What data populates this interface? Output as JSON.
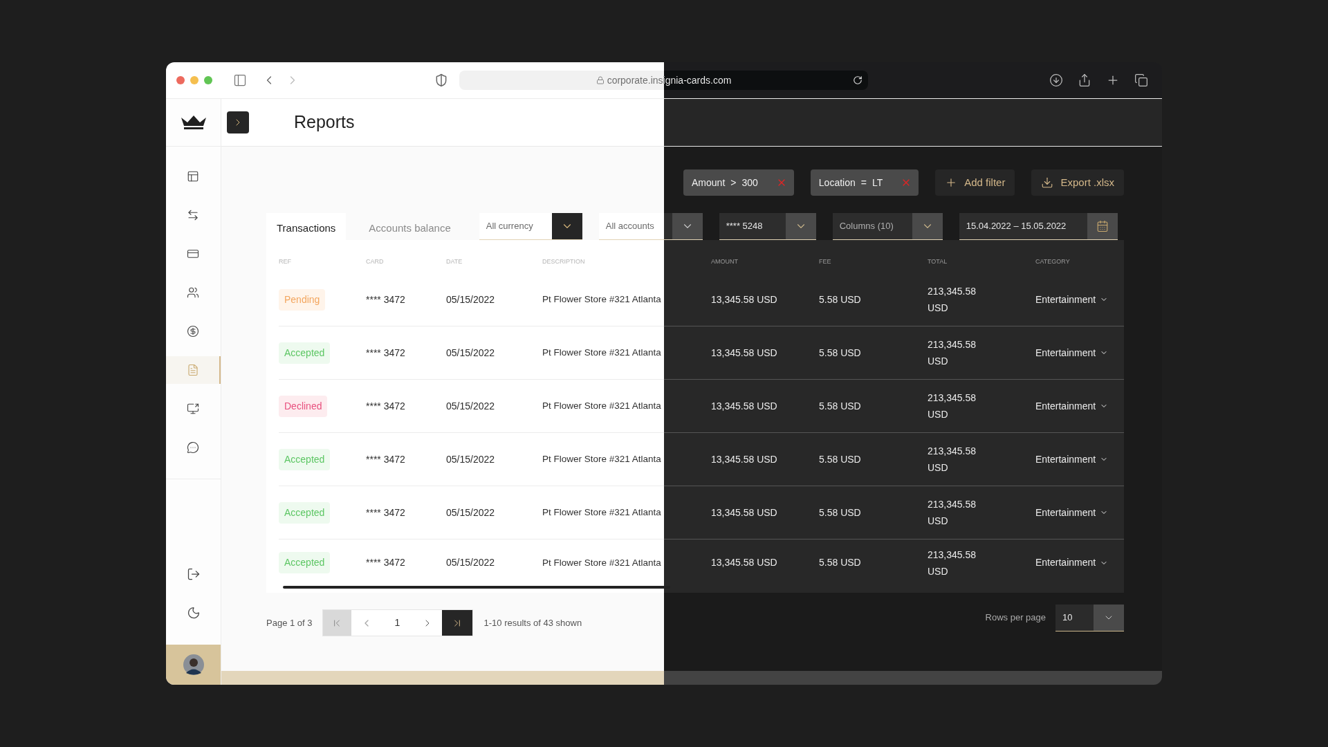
{
  "browser": {
    "url": "corporate.insignia-cards.com"
  },
  "sidebar": {
    "items": [
      {
        "selected": false
      },
      {
        "selected": false
      },
      {
        "selected": false
      },
      {
        "selected": false
      },
      {
        "selected": false
      },
      {
        "selected": true
      },
      {
        "selected": false
      },
      {
        "selected": false
      }
    ]
  },
  "header": {
    "title": "Reports"
  },
  "filters": [
    {
      "field": "Amount",
      "operator": ">",
      "value": "300"
    },
    {
      "field": "Location",
      "operator": "=",
      "value": "LT"
    }
  ],
  "actions": [
    {
      "label": "Add filter",
      "kind": "add"
    },
    {
      "label": "Export .xlsx",
      "kind": "export"
    }
  ],
  "tabs": [
    {
      "label": "Transactions",
      "selected": true
    },
    {
      "label": "Accounts balance",
      "selected": false
    }
  ],
  "dropdowns": [
    {
      "value": "All currency",
      "kind": "select"
    },
    {
      "value": "All accounts",
      "kind": "select"
    },
    {
      "value": "**** 5248",
      "kind": "select"
    },
    {
      "value": "Columns (10)",
      "kind": "select"
    },
    {
      "value": "15.04.2022 – 15.05.2022",
      "kind": "date"
    }
  ],
  "table": {
    "columns": [
      "REF",
      "CARD",
      "DATE",
      "DESCRIPTION",
      "AMOUNT",
      "FEE",
      "TOTAL",
      "CATEGORY"
    ],
    "rows": [
      {
        "status": "Pending",
        "kind": "pending",
        "card": "**** 3472",
        "date": "05/15/2022",
        "description": "Pt Flower Store #321 Atlanta",
        "amount": "13,345.58 USD",
        "fee": "5.58 USD",
        "total": "213,345.58 USD",
        "category": "Entertainment"
      },
      {
        "status": "Accepted",
        "kind": "accepted",
        "card": "**** 3472",
        "date": "05/15/2022",
        "description": "Pt Flower Store #321 Atlanta",
        "amount": "13,345.58 USD",
        "fee": "5.58 USD",
        "total": "213,345.58 USD",
        "category": "Entertainment"
      },
      {
        "status": "Declined",
        "kind": "declined",
        "card": "**** 3472",
        "date": "05/15/2022",
        "description": "Pt Flower Store #321 Atlanta",
        "amount": "13,345.58 USD",
        "fee": "5.58 USD",
        "total": "213,345.58 USD",
        "category": "Entertainment"
      },
      {
        "status": "Accepted",
        "kind": "accepted",
        "card": "**** 3472",
        "date": "05/15/2022",
        "description": "Pt Flower Store #321 Atlanta",
        "amount": "13,345.58 USD",
        "fee": "5.58 USD",
        "total": "213,345.58 USD",
        "category": "Entertainment"
      },
      {
        "status": "Accepted",
        "kind": "accepted",
        "card": "**** 3472",
        "date": "05/15/2022",
        "description": "Pt Flower Store #321 Atlanta",
        "amount": "13,345.58 USD",
        "fee": "5.58 USD",
        "total": "213,345.58 USD",
        "category": "Entertainment"
      },
      {
        "status": "Accepted",
        "kind": "accepted",
        "card": "**** 3472",
        "date": "05/15/2022",
        "description": "Pt Flower Store #321 Atlanta",
        "amount": "13,345.58 USD",
        "fee": "5.58 USD",
        "total": "213,345.58 USD",
        "category": "Entertainment"
      }
    ]
  },
  "pagination": {
    "label": "Page 1 of 3",
    "page": "1",
    "summary": "1-10 results of 43 shown",
    "first_disabled": true,
    "prev_disabled": true,
    "next_disabled": false,
    "last_disabled": false
  },
  "rows_per_page": {
    "label": "Rows per page",
    "value": "10"
  }
}
